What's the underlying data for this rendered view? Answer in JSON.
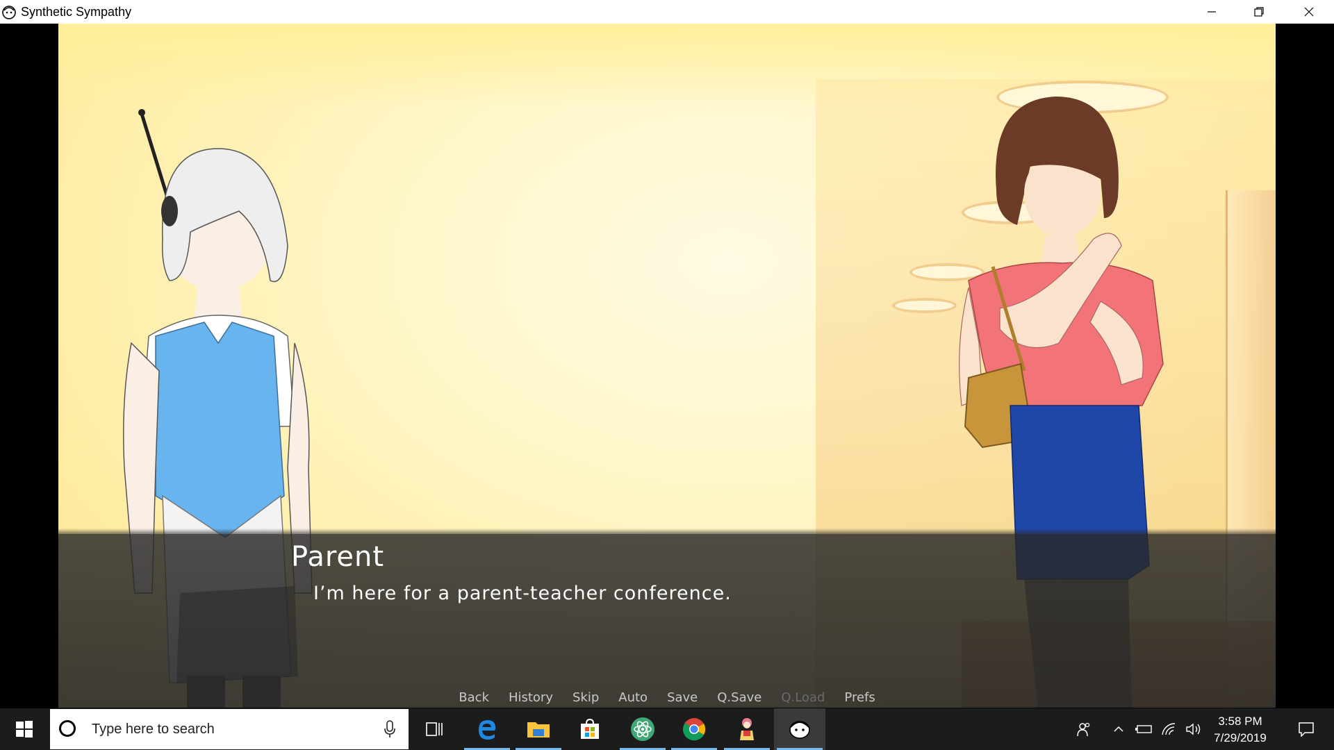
{
  "window": {
    "title": "Synthetic Sympathy",
    "app_icon": "synthetic-sympathy-icon",
    "controls": [
      "minimize-icon",
      "restore-icon",
      "close-icon"
    ]
  },
  "scene": {
    "speaker": "Parent",
    "dialogue": "I’m here for a parent-teacher conference.",
    "characters": [
      "android-teacher",
      "parent"
    ]
  },
  "quick_menu": [
    {
      "label": "Back",
      "enabled": true
    },
    {
      "label": "History",
      "enabled": true
    },
    {
      "label": "Skip",
      "enabled": true
    },
    {
      "label": "Auto",
      "enabled": true
    },
    {
      "label": "Save",
      "enabled": true
    },
    {
      "label": "Q.Save",
      "enabled": true
    },
    {
      "label": "Q.Load",
      "enabled": false
    },
    {
      "label": "Prefs",
      "enabled": true
    }
  ],
  "taskbar": {
    "search_placeholder": "Type here to search",
    "apps": [
      "task-view-icon",
      "edge-icon",
      "file-explorer-icon",
      "store-icon",
      "atom-icon",
      "chrome-icon",
      "game-character-icon",
      "synthetic-sympathy-icon"
    ],
    "tray_icons": [
      "people-icon",
      "chevron-up-icon",
      "battery-icon",
      "wifi-icon",
      "volume-icon"
    ],
    "time": "3:58 PM",
    "date": "7/29/2019",
    "notifications_icon": "action-center-icon"
  },
  "colors": {
    "accent": "#76b9ed",
    "taskbar": "#1c1c1c",
    "dialogue_box": "#2b2b2b",
    "background_glow": "#fff6c9"
  }
}
